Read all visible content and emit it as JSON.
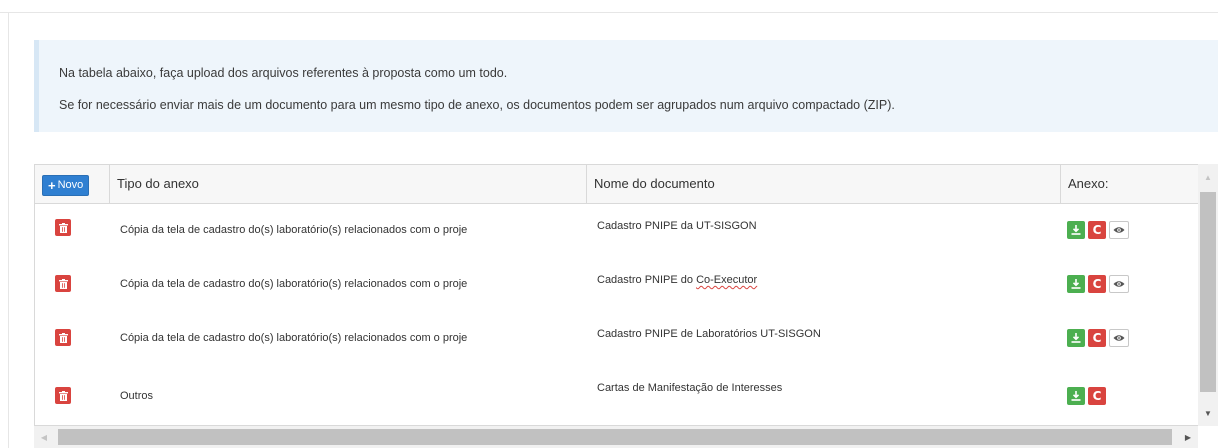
{
  "info": {
    "line1": "Na tabela abaixo, faça upload dos arquivos referentes à proposta como um todo.",
    "line2": "Se for necessário enviar mais de um documento para um mesmo tipo de anexo, os documentos podem ser agrupados num arquivo compactado (ZIP)."
  },
  "table": {
    "new_button": "Novo",
    "headers": {
      "tipo": "Tipo do anexo",
      "nome": "Nome do documento",
      "anexo": "Anexo:"
    },
    "rows": [
      {
        "tipo": "Cópia da tela de cadastro do(s) laboratório(s) relacionados com o proje",
        "nome": "Cadastro PNIPE da UT-SISGON"
      },
      {
        "tipo": "Cópia da tela de cadastro do(s) laboratório(s) relacionados com o proje",
        "nome_prefix": "Cadastro PNIPE do ",
        "nome_misspelled": "Co-Executor"
      },
      {
        "tipo": "Cópia da tela de cadastro do(s) laboratório(s) relacionados com o proje",
        "nome": "Cadastro PNIPE de Laboratórios UT-SISGON"
      },
      {
        "tipo": "Outros",
        "nome": "Cartas de Manifestação de Interesses"
      }
    ],
    "replace_label": "C"
  },
  "colors": {
    "accent": "#2f7fd1",
    "danger": "#d9443f",
    "success": "#4caf50",
    "info_bg": "#eef5fb"
  }
}
